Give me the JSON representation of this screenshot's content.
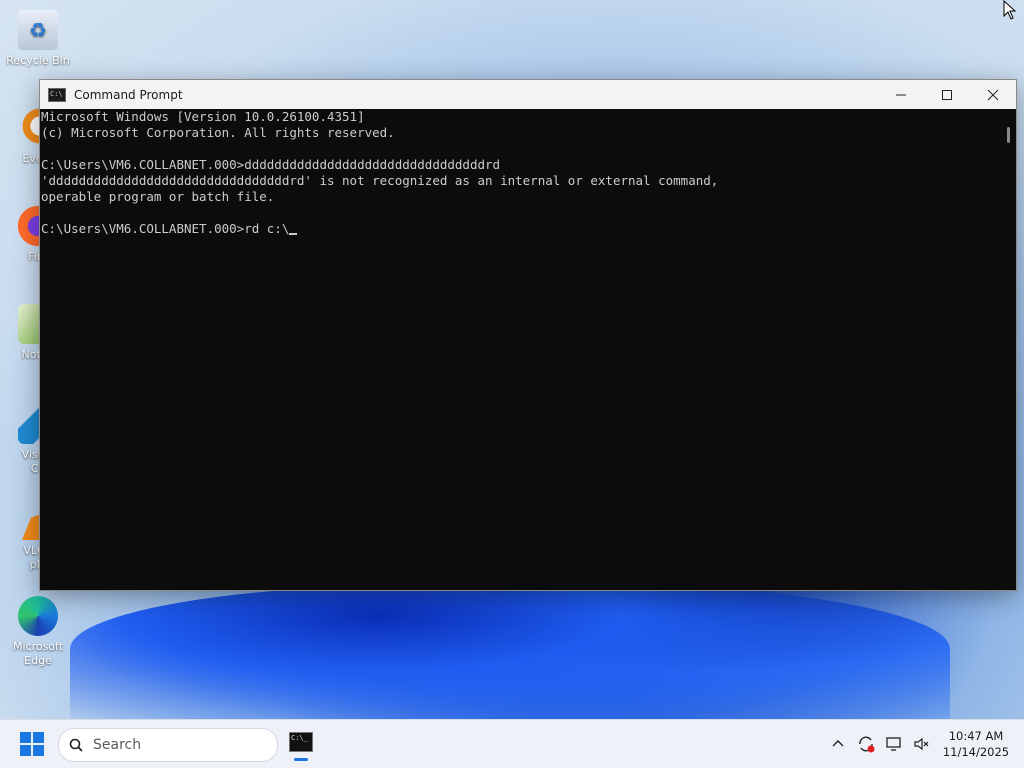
{
  "desktop": {
    "icons": [
      {
        "label": "Recycle Bin"
      },
      {
        "label": "Every"
      },
      {
        "label": "Fire"
      },
      {
        "label": "Notep"
      },
      {
        "label": "Visual\nCo"
      },
      {
        "label": "VLC r\npla"
      },
      {
        "label": "Microsoft\nEdge"
      }
    ]
  },
  "window": {
    "title": "Command Prompt",
    "controls": {
      "minimize": "—",
      "maximize": "☐",
      "close": "✕"
    },
    "console_lines": [
      "Microsoft Windows [Version 10.0.26100.4351]",
      "(c) Microsoft Corporation. All rights reserved.",
      "",
      "C:\\Users\\VM6.COLLABNET.000>ddddddddddddddddddddddddddddddddrd",
      "'ddddddddddddddddddddddddddddddddrd' is not recognized as an internal or external command,",
      "operable program or batch file.",
      "",
      "C:\\Users\\VM6.COLLABNET.000>rd c:\\"
    ]
  },
  "taskbar": {
    "search_label": "Search",
    "time": "10:47 AM",
    "date": "11/14/2025",
    "accent": "#1b78e0"
  }
}
